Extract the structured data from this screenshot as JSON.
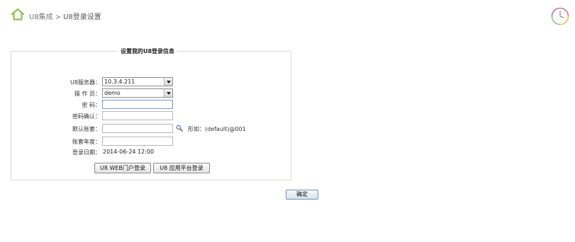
{
  "breadcrumb": {
    "parent": "U8集成",
    "separator": ">",
    "current": "U8登录设置"
  },
  "form": {
    "legend": "设置我的U8登录信息",
    "server_label": "U8服务器：",
    "server_value": "10.3.4.211",
    "operator_label": "操 作 员：",
    "operator_value": "demo",
    "password_label": "密    码：",
    "password_value": "",
    "password_confirm_label": "密码确认：",
    "password_confirm_value": "",
    "default_account_label": "默认账套：",
    "default_account_value": "",
    "default_account_hint": "形如：(default)@001",
    "account_year_label": "账套年度：",
    "account_year_value": "",
    "login_date_label": "登录日期：",
    "login_date_value": "2014-06-24 12:00",
    "web_login_button": "U8 WEB门户登录",
    "platform_login_button": "U8 应用平台登录"
  },
  "confirm_button": "确定",
  "colors": {
    "home_icon": "#8bc34a",
    "field_focus_border": "#6e9bd1"
  }
}
